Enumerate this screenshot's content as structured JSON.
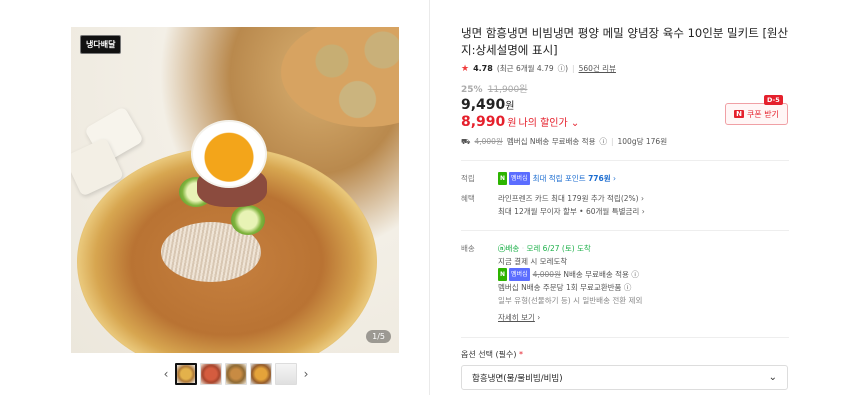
{
  "gallery": {
    "logo_text": "냉다배달",
    "counter": "1/5",
    "prev": "‹",
    "next": "›",
    "thumbnails": [
      "t1",
      "t2",
      "t3",
      "t4",
      "t5"
    ]
  },
  "product": {
    "title": "냉면 함흥냉면 비빔냉면 평양 메밀 양념장 육수 10인분 밀키트 [원산지:상세설명에 표시]",
    "rating": "4.78",
    "rating_recent": "(최근 6개월 4.79",
    "reviews": "560건 리뷰",
    "discount_pct": "25%",
    "original_price": "11,900원",
    "price_amount": "9,490",
    "price_unit": "원",
    "my_price_amount": "8,990",
    "my_price_unit": "원",
    "my_price_hint": "나의 할인가 ⌄",
    "coupon_label": "쿠폰 받기",
    "coupon_tag": "D-5",
    "coupon_n": "N",
    "shipping_fee_strike": "4,000원",
    "shipping_text": "멤버십 N배송 무료배송 적용",
    "unit_price": "100g당 176원"
  },
  "benefits": {
    "points_label": "적립",
    "points_text": "최대 적립 포인트",
    "points_value": "776원",
    "benefit_label": "혜택",
    "benefit_line1": "라인프렌즈 카드 최대 179원 추가 적립(2%)",
    "benefit_line2": "최대 12개월 무이자 할부 • 60개월 특별금리"
  },
  "delivery": {
    "label": "배송",
    "badge": "배송",
    "arrival": "모레 6/27 (토) 도착",
    "line1": "지금 결제 시 모레도착",
    "fee_strike": "4,000원",
    "fee_text": "N배송 무료배송 적용",
    "line3": "멤버십 N배송 주문당 1회 무료교환반품",
    "line4": "일부 유형(선물하기 등) 시 일반배송 전환 제외",
    "detail_link": "자세히 보기"
  },
  "option": {
    "label": "옵션 선택 (필수)",
    "required_mark": "*",
    "selected": "함흥냉면(물/물비빔/비빔)"
  },
  "badges": {
    "npay": "N",
    "membership": "멤버십"
  }
}
